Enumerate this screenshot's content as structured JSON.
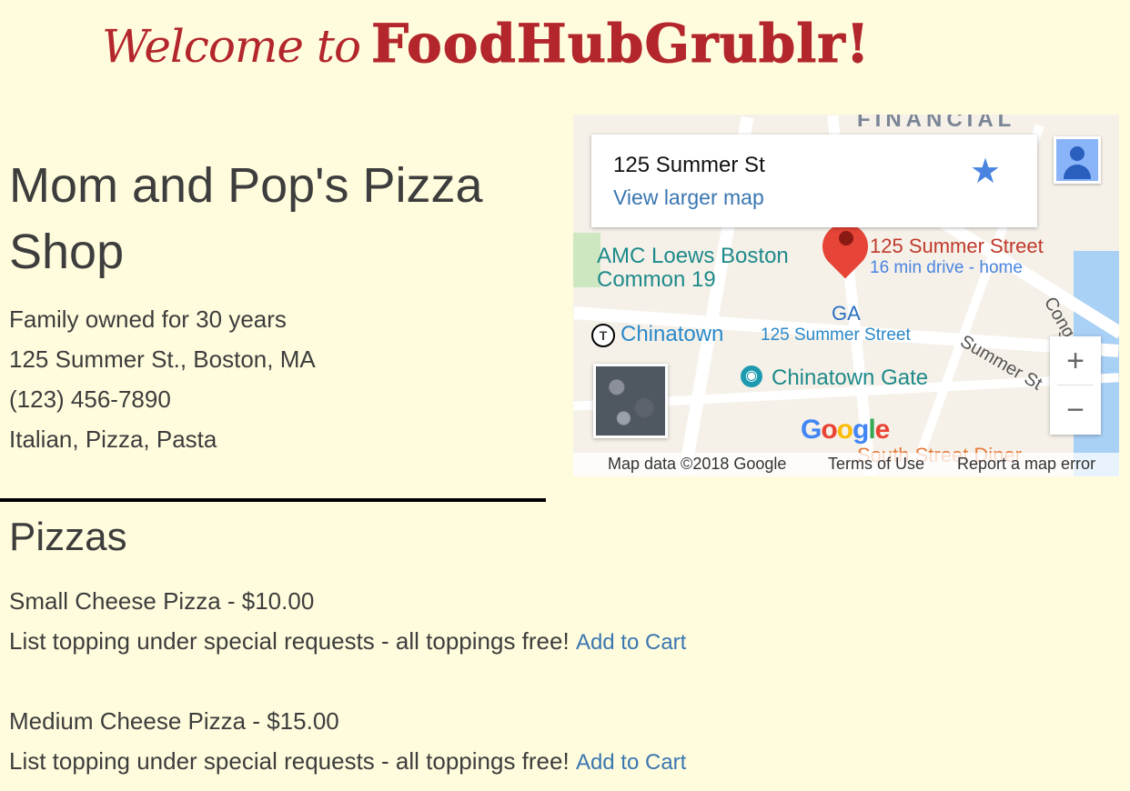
{
  "header": {
    "welcome": "Welcome to",
    "brand": "FoodHubGrublr!"
  },
  "restaurant": {
    "name": "Mom and Pop's Pizza Shop",
    "tagline": "Family owned for 30 years",
    "address": "125 Summer St., Boston, MA",
    "phone": "(123) 456-7890",
    "cuisine": "Italian, Pizza, Pasta"
  },
  "map": {
    "card_title": "125 Summer St",
    "card_link": "View larger map",
    "labels": {
      "financial": "FINANCIAL",
      "amc": "AMC Loews Boston",
      "amc2": "Common 19",
      "pin_title": "125 Summer Street",
      "pin_sub": "16 min drive - home",
      "ga": "GA",
      "chinatown": "Chinatown",
      "street": "125 Summer Street",
      "summer_st": "Summer St",
      "gate": "Chinatown Gate",
      "diner": "South Street Diner",
      "cong": "Cong"
    },
    "zoom_in": "+",
    "zoom_out": "−",
    "google": "Google",
    "footer": {
      "data": "Map data ©2018 Google",
      "terms": "Terms of Use",
      "report": "Report a map error"
    }
  },
  "menu": {
    "section_title": "Pizzas",
    "items": [
      {
        "name": "Small Cheese Pizza - $10.00",
        "description": "List topping under special requests - all toppings free!",
        "action": "Add to Cart"
      },
      {
        "name": "Medium Cheese Pizza - $15.00",
        "description": "List topping under special requests - all toppings free!",
        "action": "Add to Cart"
      }
    ]
  }
}
